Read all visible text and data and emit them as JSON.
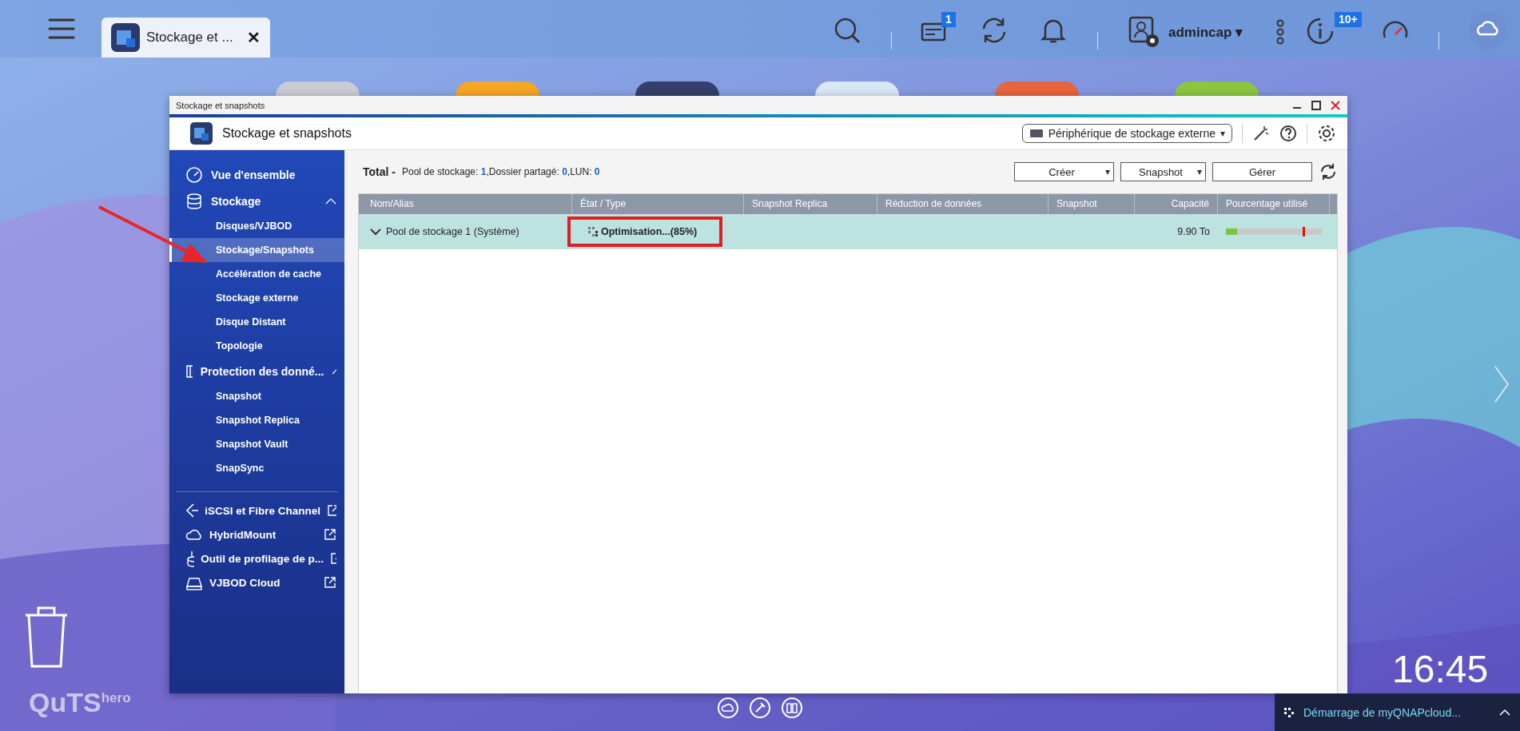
{
  "taskbar": {
    "tab": {
      "label": "Stockage et ...",
      "close": "✕"
    },
    "notif_badge": "1",
    "user": "admincap",
    "user_caret": "▾",
    "info_badge": "10+"
  },
  "window": {
    "title": "Stockage et snapshots",
    "app_title": "Stockage et snapshots",
    "device_select": "Périphérique de stockage externe",
    "device_caret": "▾"
  },
  "sidebar": {
    "groups": [
      {
        "label": "Vue d'ensemble"
      },
      {
        "label": "Stockage",
        "expanded": true,
        "children": [
          {
            "label": "Disques/VJBOD",
            "selected": false
          },
          {
            "label": "Stockage/Snapshots",
            "selected": true
          },
          {
            "label": "Accélération de cache",
            "selected": false
          },
          {
            "label": "Stockage externe",
            "selected": false
          },
          {
            "label": "Disque Distant",
            "selected": false
          },
          {
            "label": "Topologie",
            "selected": false
          }
        ]
      },
      {
        "label": "Protection des donné...",
        "expanded": true,
        "children": [
          {
            "label": "Snapshot",
            "selected": false
          },
          {
            "label": "Snapshot Replica",
            "selected": false
          },
          {
            "label": "Snapshot Vault",
            "selected": false
          },
          {
            "label": "SnapSync",
            "selected": false
          }
        ]
      }
    ],
    "links": [
      {
        "label": "iSCSI et Fibre Channel"
      },
      {
        "label": "HybridMount"
      },
      {
        "label": "Outil de profilage de p..."
      },
      {
        "label": "VJBOD Cloud"
      }
    ]
  },
  "summary": {
    "title": "Total -",
    "items": [
      {
        "label": "Pool de stockage:",
        "value": "1",
        "sep": ","
      },
      {
        "label": "Dossier partagé:",
        "value": "0",
        "sep": ","
      },
      {
        "label": "LUN:",
        "value": "0"
      }
    ]
  },
  "buttons": [
    {
      "label": "Créer",
      "caret": "▾"
    },
    {
      "label": "Snapshot",
      "caret": "▾"
    },
    {
      "label": "Gérer"
    }
  ],
  "table": {
    "columns": [
      "Nom/Alias",
      "État / Type",
      "Snapshot Replica",
      "Réduction de données",
      "Snapshot",
      "Capacité",
      "Pourcentage utilisé"
    ],
    "rows": [
      {
        "name": "Pool de stockage 1 (Système)",
        "expanded": true,
        "status": "Optimisation...(85%)",
        "capacity": "9.90 To",
        "level": 0.12
      }
    ]
  },
  "desktop": {
    "logo": "QuTS",
    "logo_sup": "hero",
    "clock": "16:45",
    "notification": "Démarrage de myQNAPcloud..."
  }
}
